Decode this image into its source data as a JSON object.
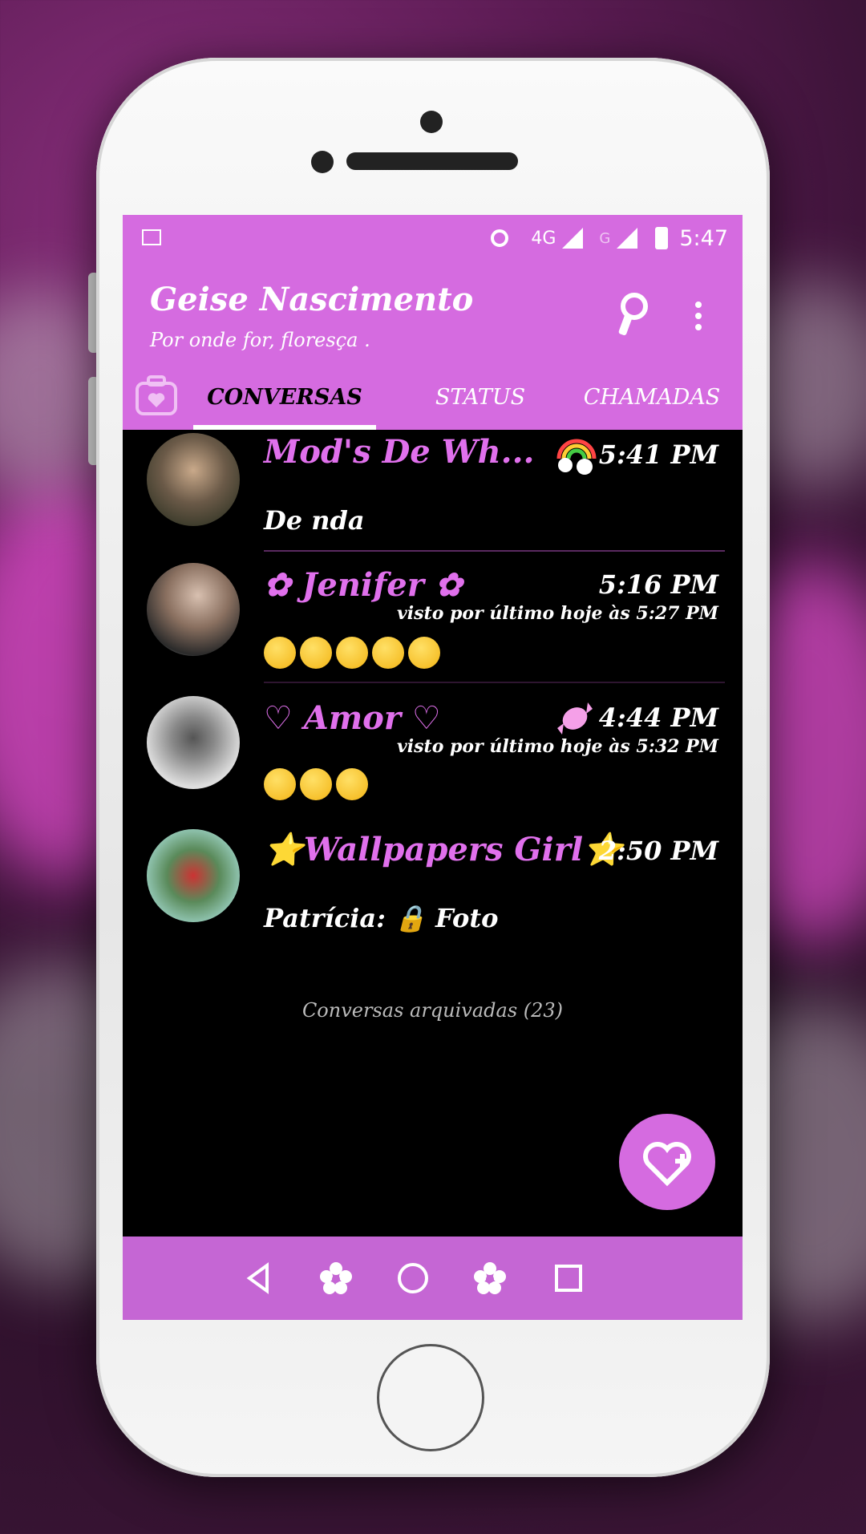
{
  "status_bar": {
    "network": "4G",
    "network_secondary": "G",
    "time": "5:47"
  },
  "app_bar": {
    "title": "Geise Nascimento",
    "subtitle": "Por onde for, floresça ."
  },
  "tabs": [
    {
      "label": "CONVERSAS",
      "active": true
    },
    {
      "label": "STATUS",
      "active": false
    },
    {
      "label": "CHAMADAS",
      "active": false
    }
  ],
  "chats": [
    {
      "name": "Mod's De Wh...",
      "time": "5:41 PM",
      "seen": "",
      "message": "De nda"
    },
    {
      "name": "✿ Jenifer ✿",
      "time": "5:16 PM",
      "seen": "visto por último hoje às 5:27 PM",
      "message": "",
      "emoji_count": 5
    },
    {
      "name": "♡ Amor ♡",
      "time": "4:44 PM",
      "seen": "visto por último hoje às 5:32 PM",
      "message": "",
      "emoji_count": 3
    },
    {
      "name": "⭐Wallpapers Girl⭐",
      "time": "2:50 PM",
      "seen": "",
      "message": "Patrícia: 🔒 Foto"
    }
  ],
  "archived": "Conversas arquivadas (23)",
  "colors": {
    "accent": "#d56be0",
    "name_color": "#e070ec",
    "screen_bg": "#000000"
  },
  "icons": [
    "search-icon",
    "more-icon",
    "camera-icon",
    "new-chat-icon",
    "back-icon",
    "home-icon",
    "recents-icon"
  ]
}
